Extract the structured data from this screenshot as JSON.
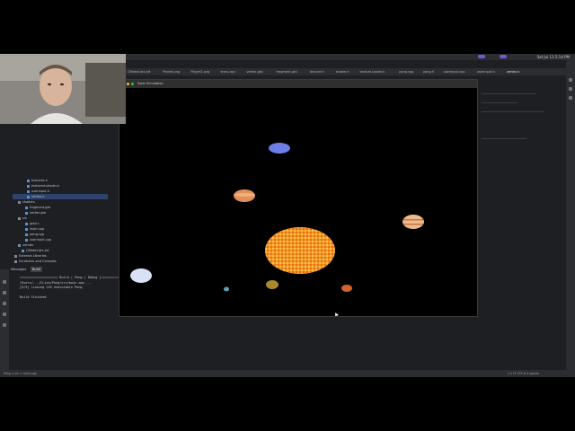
{
  "menubar": {
    "clock": "Sat Jul 13  5:14 PM"
  },
  "tabs": [
    {
      "label": "CMakeLists.txt"
    },
    {
      "label": "Planet.png"
    },
    {
      "label": "Player2.png"
    },
    {
      "label": "stars.cpp"
    },
    {
      "label": "vertex.glsl"
    },
    {
      "label": "fragment.glsl"
    },
    {
      "label": "texture.h"
    },
    {
      "label": "shader.h"
    },
    {
      "label": "texture-loader.h"
    },
    {
      "label": "pong.cpp"
    },
    {
      "label": "pong.h"
    },
    {
      "label": "userinput.cpp"
    },
    {
      "label": "userinput.h"
    },
    {
      "label": "vertex.h",
      "active": true
    }
  ],
  "project_tree": [
    {
      "label": "textures.h",
      "indent": 30
    },
    {
      "label": "textured-shader.h",
      "indent": 30
    },
    {
      "label": "userinput.h",
      "indent": 30
    },
    {
      "label": "vertex.h",
      "indent": 30,
      "selected": true
    },
    {
      "label": "shaders",
      "indent": 20,
      "folder": true
    },
    {
      "label": "fragment.glsl",
      "indent": 28
    },
    {
      "label": "vertex.glsl",
      "indent": 28
    },
    {
      "label": "src",
      "indent": 20,
      "folder": true
    },
    {
      "label": "glad.c",
      "indent": 28
    },
    {
      "label": "main.cpp",
      "indent": 28
    },
    {
      "label": "pong.cpp",
      "indent": 28
    },
    {
      "label": "userinput.cpp",
      "indent": 28
    },
    {
      "label": "vendor",
      "indent": 20,
      "folder": true
    },
    {
      "label": "CMakeLists.txt",
      "indent": 24
    },
    {
      "label": "External Libraries",
      "indent": 16,
      "folder": true
    },
    {
      "label": "Scratches and Consoles",
      "indent": 16,
      "folder": true
    }
  ],
  "messages": {
    "title": "Messages",
    "tab": "Build",
    "lines": [
      "===================| Build | Pong | Debug |===================",
      "/Users/.../CLion/Pong/src/main.cpp ...",
      "[5/5] Linking CXX executable Pong",
      "",
      "Build finished"
    ]
  },
  "statusbar": {
    "left": "Pong  >  src  >  main.cpp",
    "right": "1:1   LF   UTF-8   4 spaces"
  },
  "sim": {
    "title": "Solar Simulation",
    "colors": {
      "sun_outer": "#e8741c",
      "sun_inner": "#f6b83a",
      "background": "#000000"
    }
  },
  "planets": [
    {
      "name": "sun",
      "color": "#ee8a22"
    },
    {
      "name": "blue-planet-top",
      "color": "#6d7fe6"
    },
    {
      "name": "orange-planet",
      "color": "#e0905a"
    },
    {
      "name": "striped-planet",
      "color": "#f0b98a"
    },
    {
      "name": "white-planet",
      "color": "#d8e2f4"
    },
    {
      "name": "small-cyan-planet",
      "color": "#5fa0b0"
    },
    {
      "name": "olive-planet",
      "color": "#a88a2c"
    },
    {
      "name": "red-planet",
      "color": "#d0642a"
    },
    {
      "name": "ringed-planet",
      "color": "#e8b88a"
    }
  ]
}
